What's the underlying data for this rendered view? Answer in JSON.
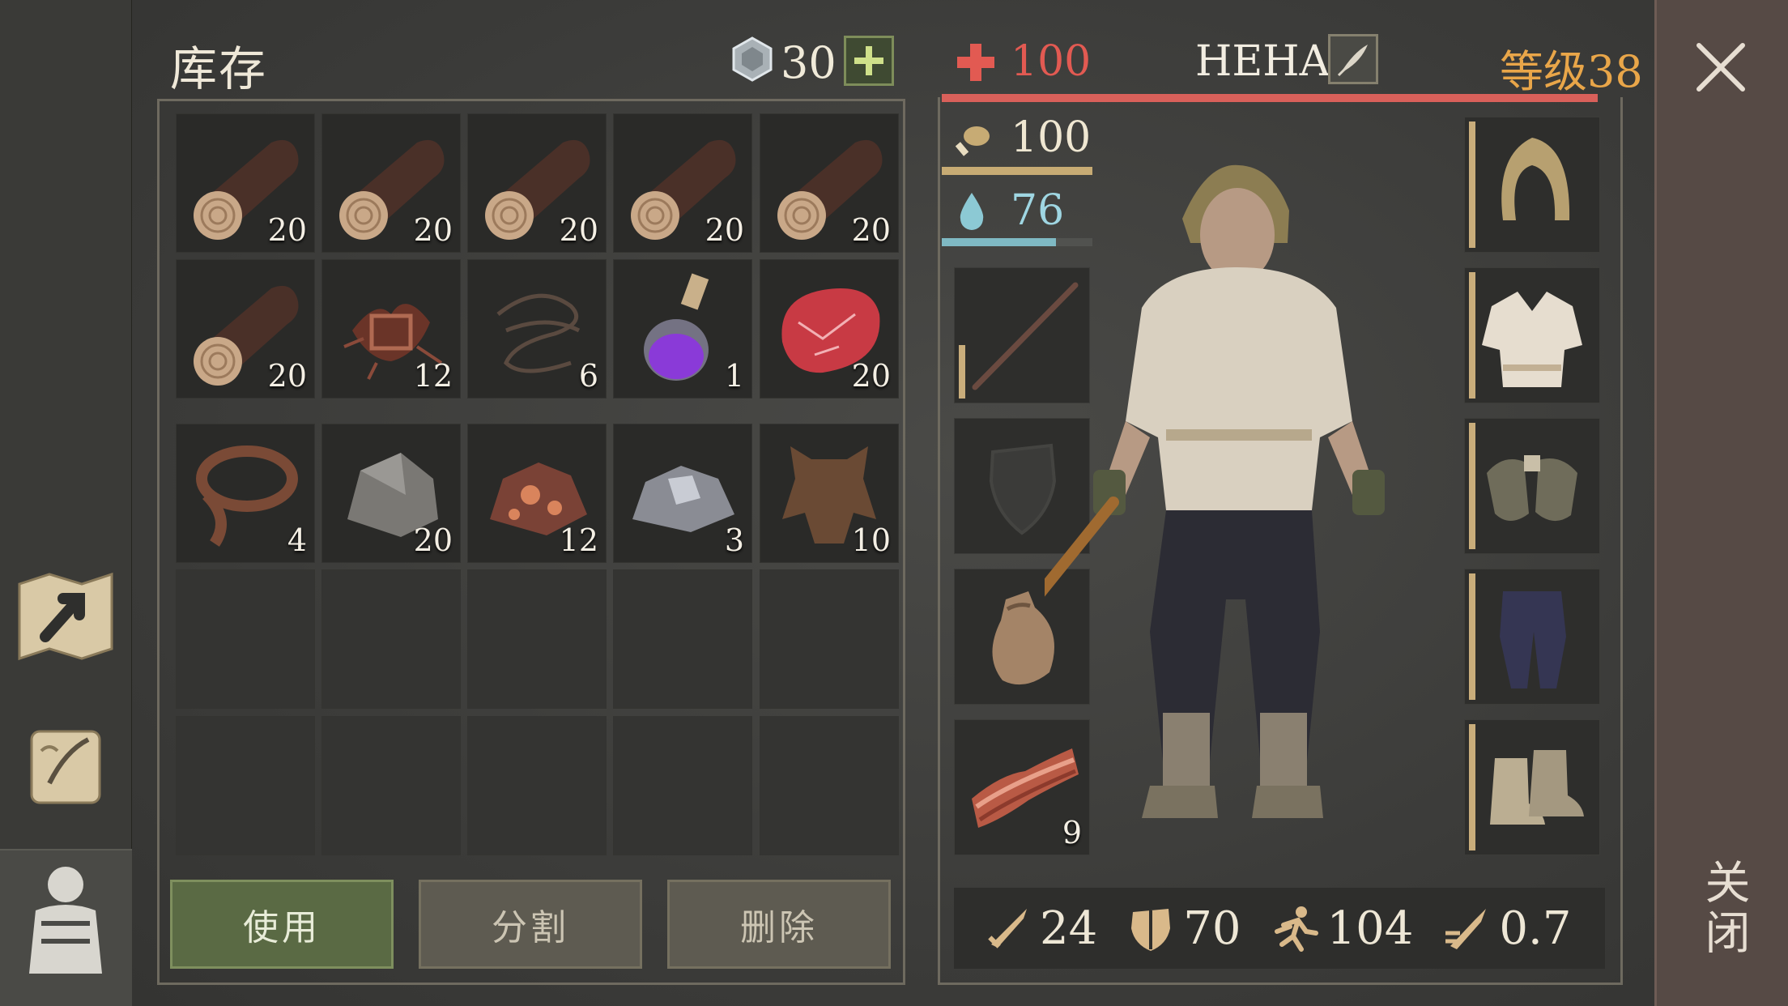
{
  "inventory": {
    "title": "库存",
    "gems": "30",
    "add_icon": "plus-icon",
    "slots": [
      {
        "item": "log",
        "qty": "20"
      },
      {
        "item": "log",
        "qty": "20"
      },
      {
        "item": "log",
        "qty": "20"
      },
      {
        "item": "log",
        "qty": "20"
      },
      {
        "item": "log",
        "qty": "20"
      },
      {
        "item": "log",
        "qty": "20"
      },
      {
        "item": "roots",
        "qty": "12"
      },
      {
        "item": "rope",
        "qty": "6"
      },
      {
        "item": "potion",
        "qty": "1"
      },
      {
        "item": "raw-meat",
        "qty": "20"
      },
      {
        "item": "leather-strip",
        "qty": "4"
      },
      {
        "item": "stone",
        "qty": "20"
      },
      {
        "item": "copper-ore",
        "qty": "12"
      },
      {
        "item": "iron-ore",
        "qty": "3"
      },
      {
        "item": "hide",
        "qty": "10"
      }
    ],
    "buttons": {
      "use": "使用",
      "split": "分割",
      "delete": "删除"
    }
  },
  "character": {
    "hp": "100",
    "name": "HEHA",
    "level": "等级38",
    "food": "100",
    "water": "76",
    "water_fraction": 0.76,
    "hand_slots": [
      {
        "item": "stick",
        "qty": ""
      },
      {
        "item": "shield-placeholder",
        "qty": ""
      },
      {
        "item": "sack",
        "qty": ""
      },
      {
        "item": "bacon",
        "qty": "9"
      }
    ],
    "armor_slots": [
      "hood",
      "shirt",
      "gloves",
      "pants",
      "boots"
    ],
    "stats": {
      "attack": "24",
      "defense": "70",
      "speed": "104",
      "attack_speed": "0.7"
    }
  },
  "close": {
    "label": "关闭"
  },
  "colors": {
    "hp": "#e25a52",
    "level": "#e9a649",
    "water": "#7fb9c3",
    "food": "#c7ab74",
    "use_button": "#5a6a44"
  }
}
